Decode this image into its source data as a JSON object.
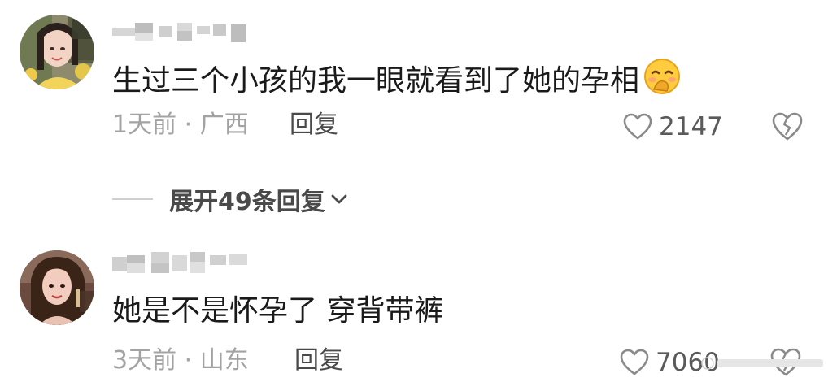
{
  "comments": [
    {
      "username": "",
      "text": "生过三个小孩的我一眼就看到了她的孕相",
      "emoji": "shy-face-emoji",
      "time": "1天前",
      "separator": "·",
      "location": "广西",
      "reply_label": "回复",
      "likes": "2147",
      "expand_replies": "展开49条回复"
    },
    {
      "username": "",
      "text": "她是不是怀孕了 穿背带裤",
      "time": "3天前",
      "separator": "·",
      "location": "山东",
      "reply_label": "回复",
      "likes": "7060"
    }
  ],
  "icons": {
    "like": "heart-outline-icon",
    "dislike": "broken-heart-icon",
    "expand": "chevron-down-icon"
  },
  "colors": {
    "text_primary": "#1a1a1a",
    "text_secondary": "#a3a3a3",
    "reply": "#4a4a4a",
    "background": "#ffffff"
  }
}
